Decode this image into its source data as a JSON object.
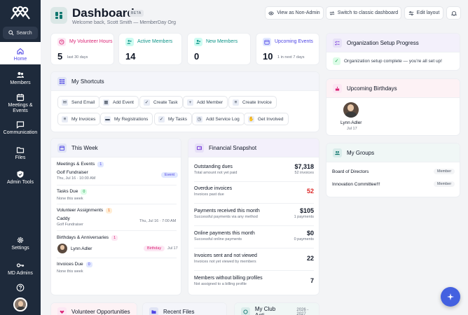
{
  "sidebar": {
    "search_label": "Search",
    "items": [
      {
        "label": "Home",
        "icon": "home-icon"
      },
      {
        "label": "Members",
        "icon": "users-icon"
      },
      {
        "label": "Meetings &\nEvents",
        "icon": "calendar-icon"
      },
      {
        "label": "Communication",
        "icon": "chat-icon"
      },
      {
        "label": "Files",
        "icon": "folder-icon"
      },
      {
        "label": "Admin Tools",
        "icon": "shield-icon"
      },
      {
        "label": "Settings",
        "icon": "gear-icon"
      },
      {
        "label": "MD Admins",
        "icon": "key-icon"
      }
    ]
  },
  "header": {
    "title": "Dashboard",
    "beta": "BETA",
    "subtitle": "Welcome back, Scott Smith — MemberDay Org",
    "view_as": "View as Non-Admin",
    "switch_classic": "Switch to classic dashboard",
    "edit_layout": "Edit layout"
  },
  "stats": [
    {
      "label": "My Volunteer Hours",
      "value": "5",
      "sub": "last 30 days",
      "color": "#db2777"
    },
    {
      "label": "Active Members",
      "value": "14",
      "sub": "",
      "color": "#0d9488"
    },
    {
      "label": "New Members",
      "value": "0",
      "sub": "",
      "color": "#0d9488"
    },
    {
      "label": "Upcoming Events",
      "value": "10",
      "sub": "1 in next 7 days",
      "color": "#4f46e5"
    }
  ],
  "shortcuts": {
    "title": "My Shortcuts",
    "row1": [
      "Send Email",
      "Add Event",
      "Create Task",
      "Add Member",
      "Create Invoice"
    ],
    "row2": [
      "My Invoices",
      "My Registrations",
      "My Tasks",
      "Add Service Log",
      "Get Involved"
    ]
  },
  "this_week": {
    "title": "This Week",
    "meetings": {
      "label": "Meetings & Events",
      "count": "1",
      "item_title": "Golf Fundraiser",
      "item_time": "Thu, Jul 16 · 10:00 AM",
      "badge": "Event"
    },
    "tasks": {
      "label": "Tasks Due",
      "count": "0",
      "empty": "None this week"
    },
    "volunteer": {
      "label": "Volunteer Assignments",
      "count": "1",
      "item_title": "Caddy",
      "item_sub": "Golf Fundraiser",
      "item_time": "Thu, Jul 16 · 7:00 AM"
    },
    "birthdays": {
      "label": "Birthdays & Anniversaries",
      "count": "1",
      "name": "Lynn Adler",
      "badge": "Birthday",
      "date": "Jul 17"
    },
    "invoices": {
      "label": "Invoices Due",
      "count": "0",
      "empty": "None this week"
    }
  },
  "financial": {
    "title": "Financial Snapshot",
    "rows": [
      {
        "label": "Outstanding dues",
        "sub": "Total amount not yet paid",
        "value": "$7,318",
        "vsub": "52 invoices",
        "color": "#111827"
      },
      {
        "label": "Overdue invoices",
        "sub": "Invoices past due",
        "value": "52",
        "vsub": "",
        "color": "#dc2626"
      },
      {
        "label": "Payments received this month",
        "sub": "Successful payments via any method",
        "value": "$105",
        "vsub": "1 payments",
        "color": "#111827"
      },
      {
        "label": "Online payments this month",
        "sub": "Successful online payments",
        "value": "$0",
        "vsub": "0 payments",
        "color": "#111827"
      },
      {
        "label": "Invoices sent and not viewed",
        "sub": "Invoices not yet viewed by members",
        "value": "22",
        "vsub": "",
        "color": "#111827"
      },
      {
        "label": "Members without billing profiles",
        "sub": "Not assigned to a billing profile",
        "value": "7",
        "vsub": "",
        "color": "#111827"
      }
    ]
  },
  "org_setup": {
    "title": "Organization Setup Progress",
    "message": "Organization setup complete — you're all set up!"
  },
  "birthdays": {
    "title": "Upcoming Birthdays",
    "name": "Lynn Adler",
    "date": "Jul 17"
  },
  "groups": {
    "title": "My Groups",
    "items": [
      {
        "name": "Board of Directors",
        "role": "Member"
      },
      {
        "name": "Innovation Committee!!!",
        "role": "Member"
      }
    ]
  },
  "bottom_cards": {
    "volunteer": "Volunteer Opportunities",
    "files": "Recent Files",
    "club": "My Club Acti...",
    "club_year": "2026 - 2027"
  }
}
